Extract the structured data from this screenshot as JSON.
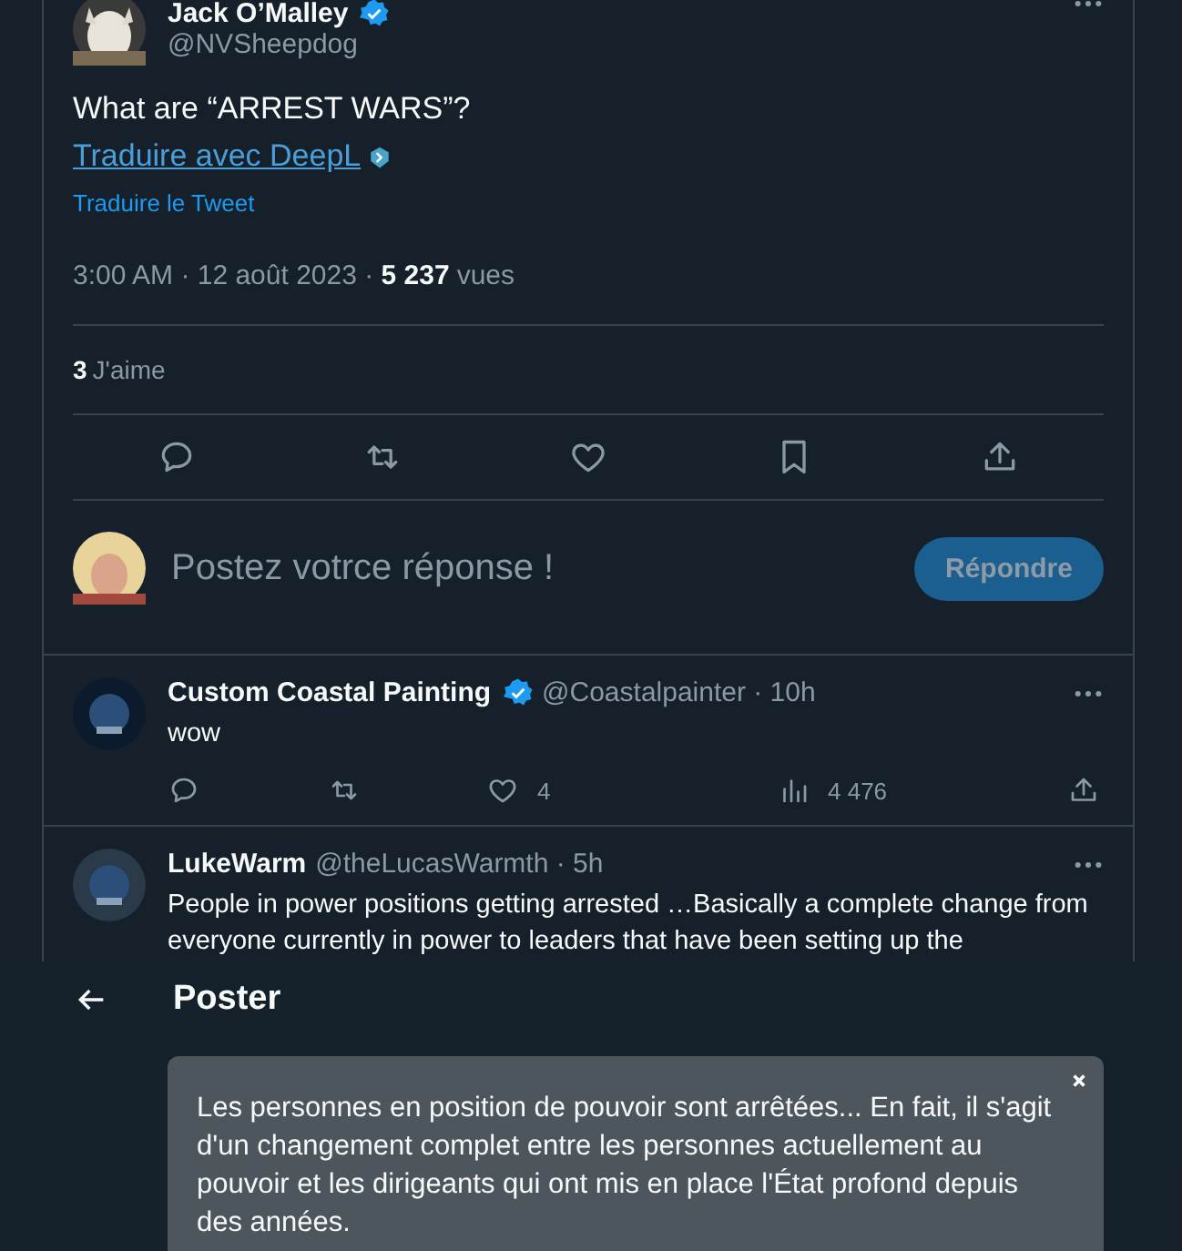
{
  "tweet": {
    "author": {
      "name": "Jack O’Malley",
      "handle": "@NVSheepdog",
      "verified": true
    },
    "text": "What are “ARREST WARS”?",
    "translate_deepl": "Traduire avec DeepL",
    "translate_tweet": "Traduire le Tweet",
    "time": "3:00 AM · 12 août 2023 · ",
    "views_count": "5 237",
    "views_label": "vues",
    "likes_count": "3",
    "likes_label": "J'aime",
    "actions": [
      {
        "kind": "reply"
      },
      {
        "kind": "retweet"
      },
      {
        "kind": "like"
      },
      {
        "kind": "bookmark"
      },
      {
        "kind": "share"
      }
    ]
  },
  "composer": {
    "placeholder": "Postez votrce réponse !",
    "button": "Répondre"
  },
  "replies": [
    {
      "name": "Custom Coastal Painting",
      "handle": "@Coastalpainter · 10h",
      "verified": true,
      "text": "wow",
      "likes": "4",
      "views": "4 476"
    },
    {
      "name": "LukeWarm",
      "handle": "@theLucasWarmth · 5h",
      "verified": false,
      "text": "People in power positions getting arrested …Basically a complete change from everyone currently in power to leaders that have been setting up the"
    }
  ],
  "overlay": {
    "title": "Poster",
    "translation": "Les personnes en position de pouvoir sont arrêtées... En fait, il s'agit d'un changement complet entre les personnes actuellement au pouvoir et les dirigeants qui ont mis en place l'État profond depuis des années."
  }
}
